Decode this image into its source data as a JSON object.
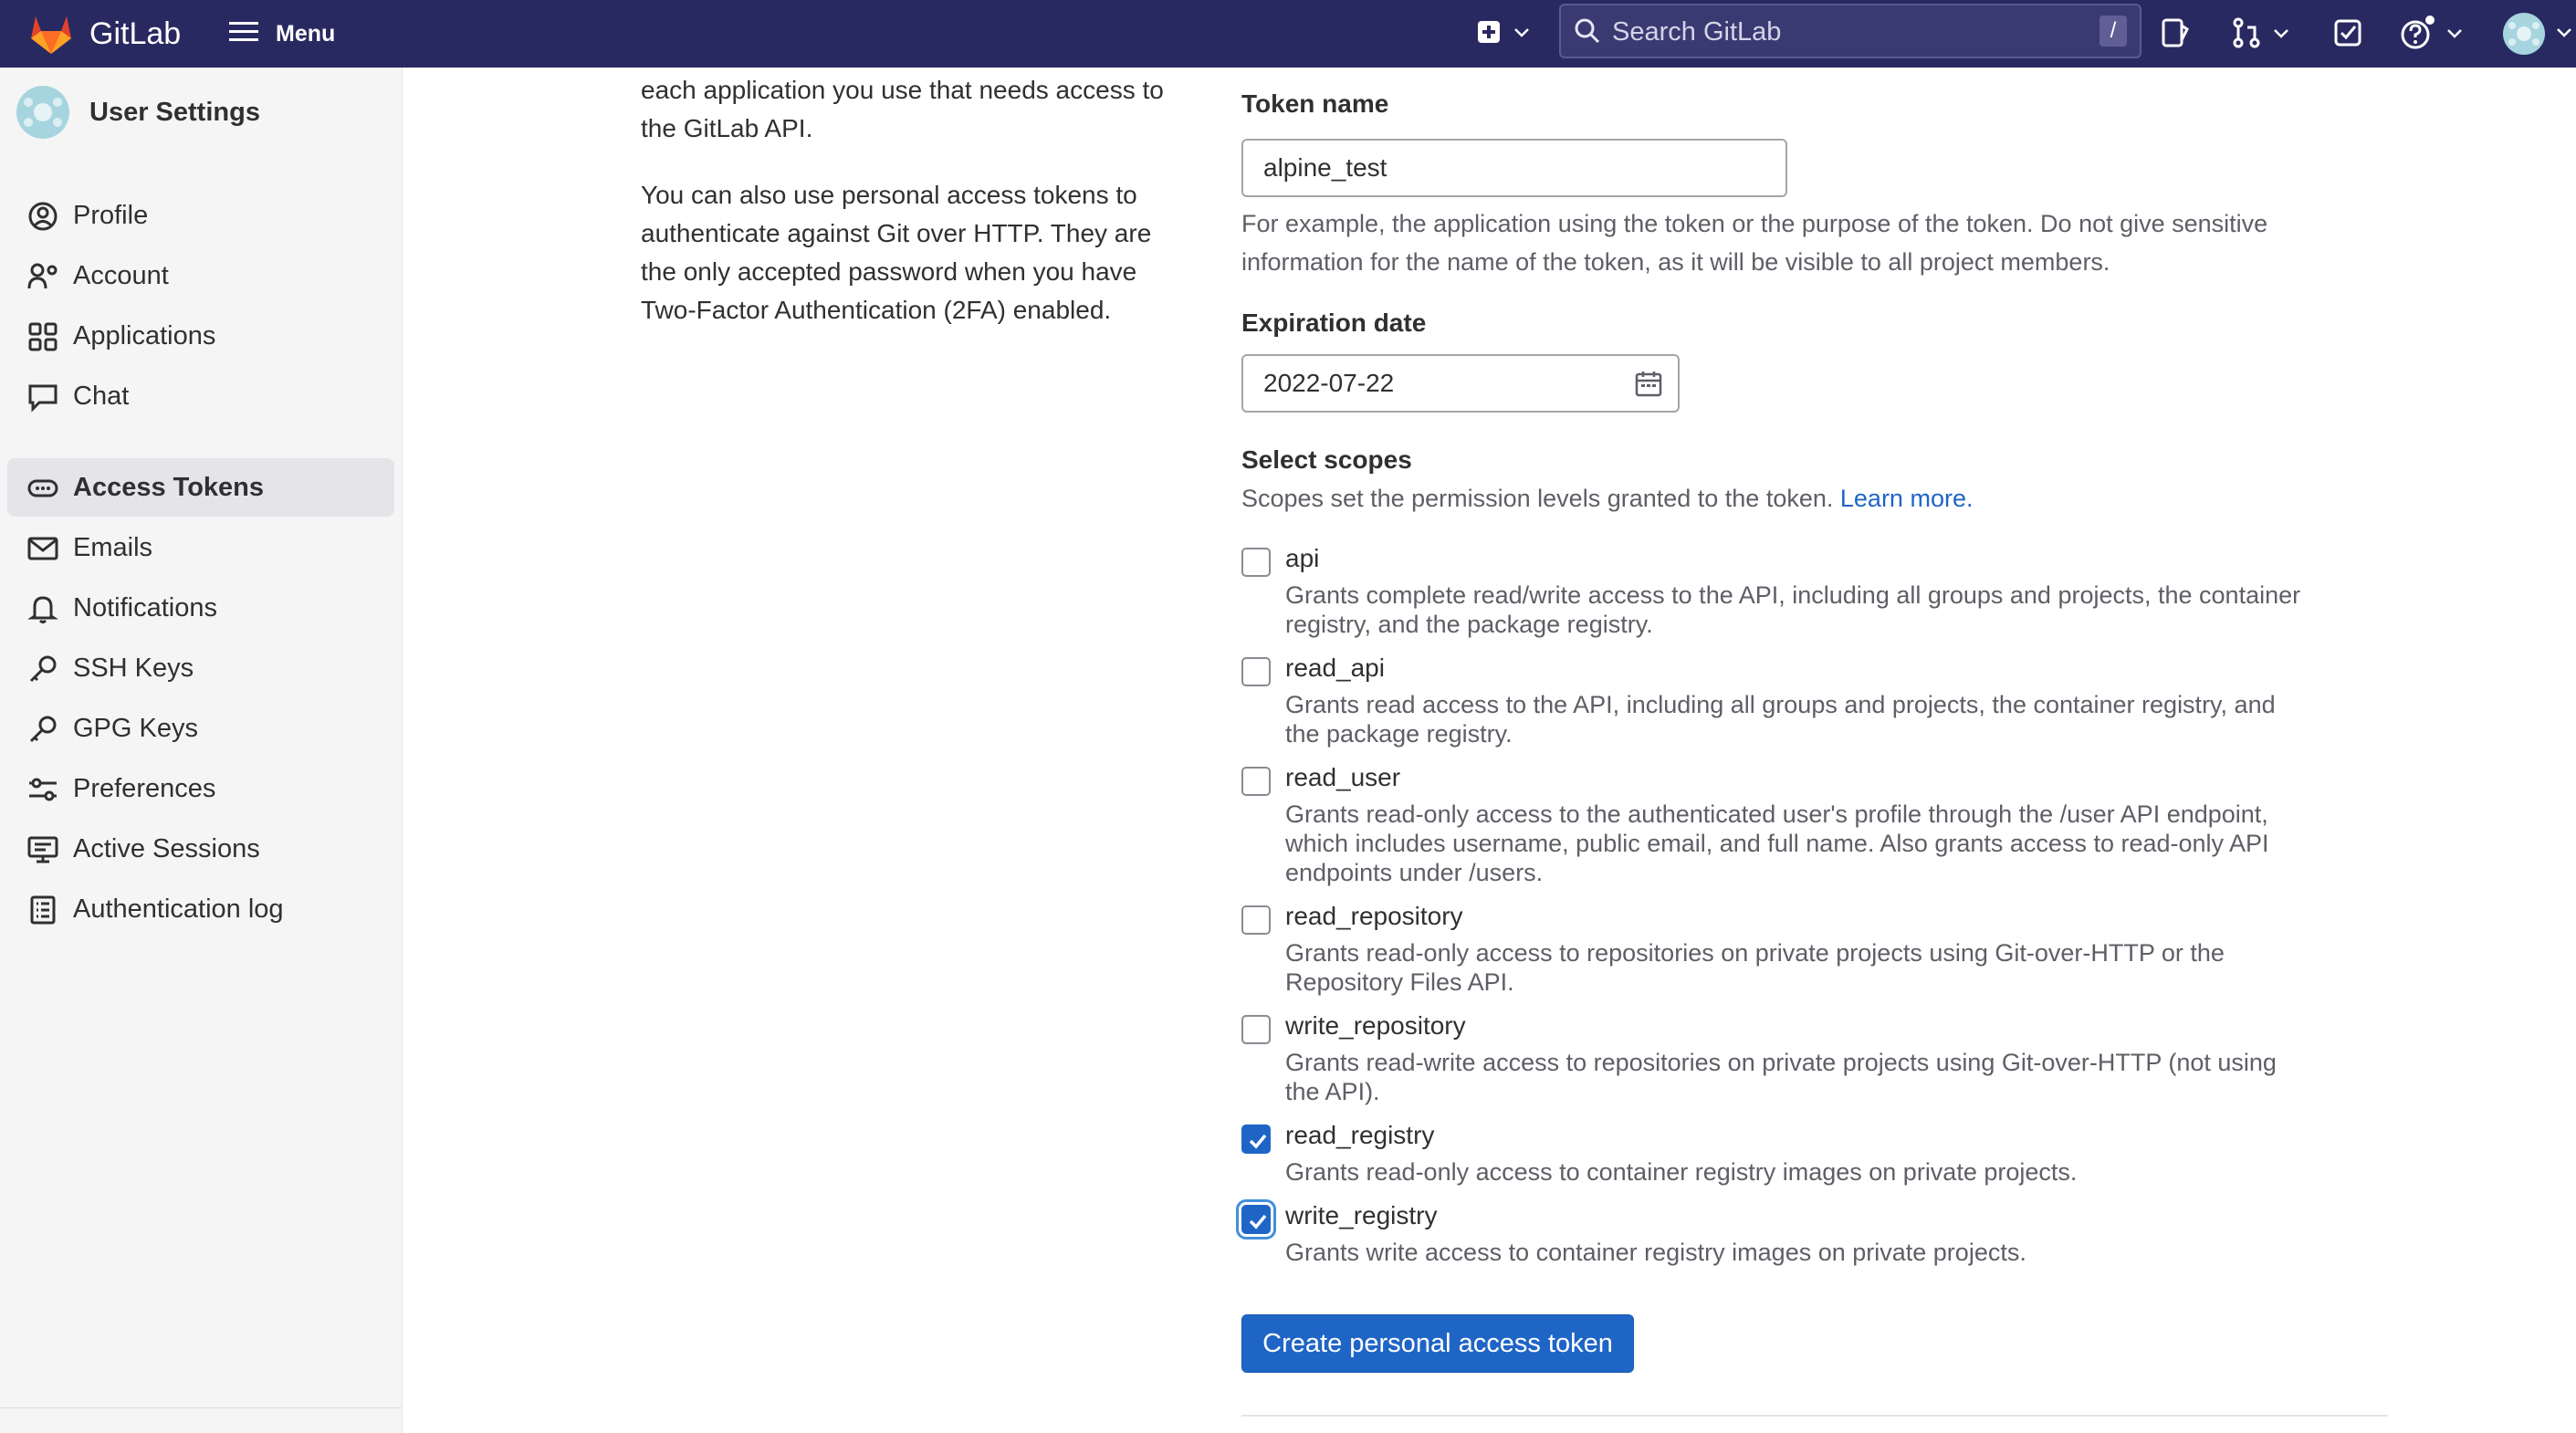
{
  "topbar": {
    "brand": "GitLab",
    "menu_label": "Menu",
    "search_placeholder": "Search GitLab",
    "search_shortcut": "/"
  },
  "sidebar": {
    "title": "User Settings",
    "items": [
      {
        "label": "Profile",
        "icon": "profile-icon"
      },
      {
        "label": "Account",
        "icon": "account-icon"
      },
      {
        "label": "Applications",
        "icon": "applications-icon"
      },
      {
        "label": "Chat",
        "icon": "chat-icon"
      },
      {
        "label": "Access Tokens",
        "icon": "token-icon",
        "active": true
      },
      {
        "label": "Emails",
        "icon": "mail-icon"
      },
      {
        "label": "Notifications",
        "icon": "bell-icon"
      },
      {
        "label": "SSH Keys",
        "icon": "key-icon"
      },
      {
        "label": "GPG Keys",
        "icon": "key-icon"
      },
      {
        "label": "Preferences",
        "icon": "preferences-icon"
      },
      {
        "label": "Active Sessions",
        "icon": "monitor-icon"
      },
      {
        "label": "Authentication log",
        "icon": "log-icon"
      }
    ]
  },
  "description": {
    "line1": "each application you use that needs access to",
    "line2": "the GitLab API.",
    "para2_line1": "You can also use personal access tokens to",
    "para2_line2": "authenticate against Git over HTTP. They are",
    "para2_line3": "the only accepted password when you have",
    "para2_line4": "Two-Factor Authentication (2FA) enabled."
  },
  "form": {
    "token_name_label": "Token name",
    "token_name_value": "alpine_test",
    "token_name_help_line1": "For example, the application using the token or the purpose of the token. Do not give sensitive",
    "token_name_help_line2": "information for the name of the token, as it will be visible to all project members.",
    "expiration_label": "Expiration date",
    "expiration_value": "2022-07-22",
    "scopes_label": "Select scopes",
    "scopes_help": "Scopes set the permission levels granted to the token.",
    "scopes_learn_more": "Learn more.",
    "scopes": [
      {
        "name": "api",
        "checked": false,
        "lines": [
          "Grants complete read/write access to the API, including all groups and projects, the container",
          "registry, and the package registry."
        ]
      },
      {
        "name": "read_api",
        "checked": false,
        "lines": [
          "Grants read access to the API, including all groups and projects, the container registry, and",
          "the package registry."
        ]
      },
      {
        "name": "read_user",
        "checked": false,
        "lines": [
          "Grants read-only access to the authenticated user's profile through the /user API endpoint,",
          "which includes username, public email, and full name. Also grants access to read-only API",
          "endpoints under /users."
        ]
      },
      {
        "name": "read_repository",
        "checked": false,
        "lines": [
          "Grants read-only access to repositories on private projects using Git-over-HTTP or the",
          "Repository Files API."
        ]
      },
      {
        "name": "write_repository",
        "checked": false,
        "lines": [
          "Grants read-write access to repositories on private projects using Git-over-HTTP (not using",
          "the API)."
        ]
      },
      {
        "name": "read_registry",
        "checked": true,
        "lines": [
          "Grants read-only access to container registry images on private projects."
        ]
      },
      {
        "name": "write_registry",
        "checked": true,
        "focused": true,
        "lines": [
          "Grants write access to container registry images on private projects."
        ]
      }
    ],
    "submit_label": "Create personal access token"
  },
  "colors": {
    "topbar": "#292961",
    "primary": "#1f65c6",
    "sidebar_bg": "#f5f5f5"
  }
}
